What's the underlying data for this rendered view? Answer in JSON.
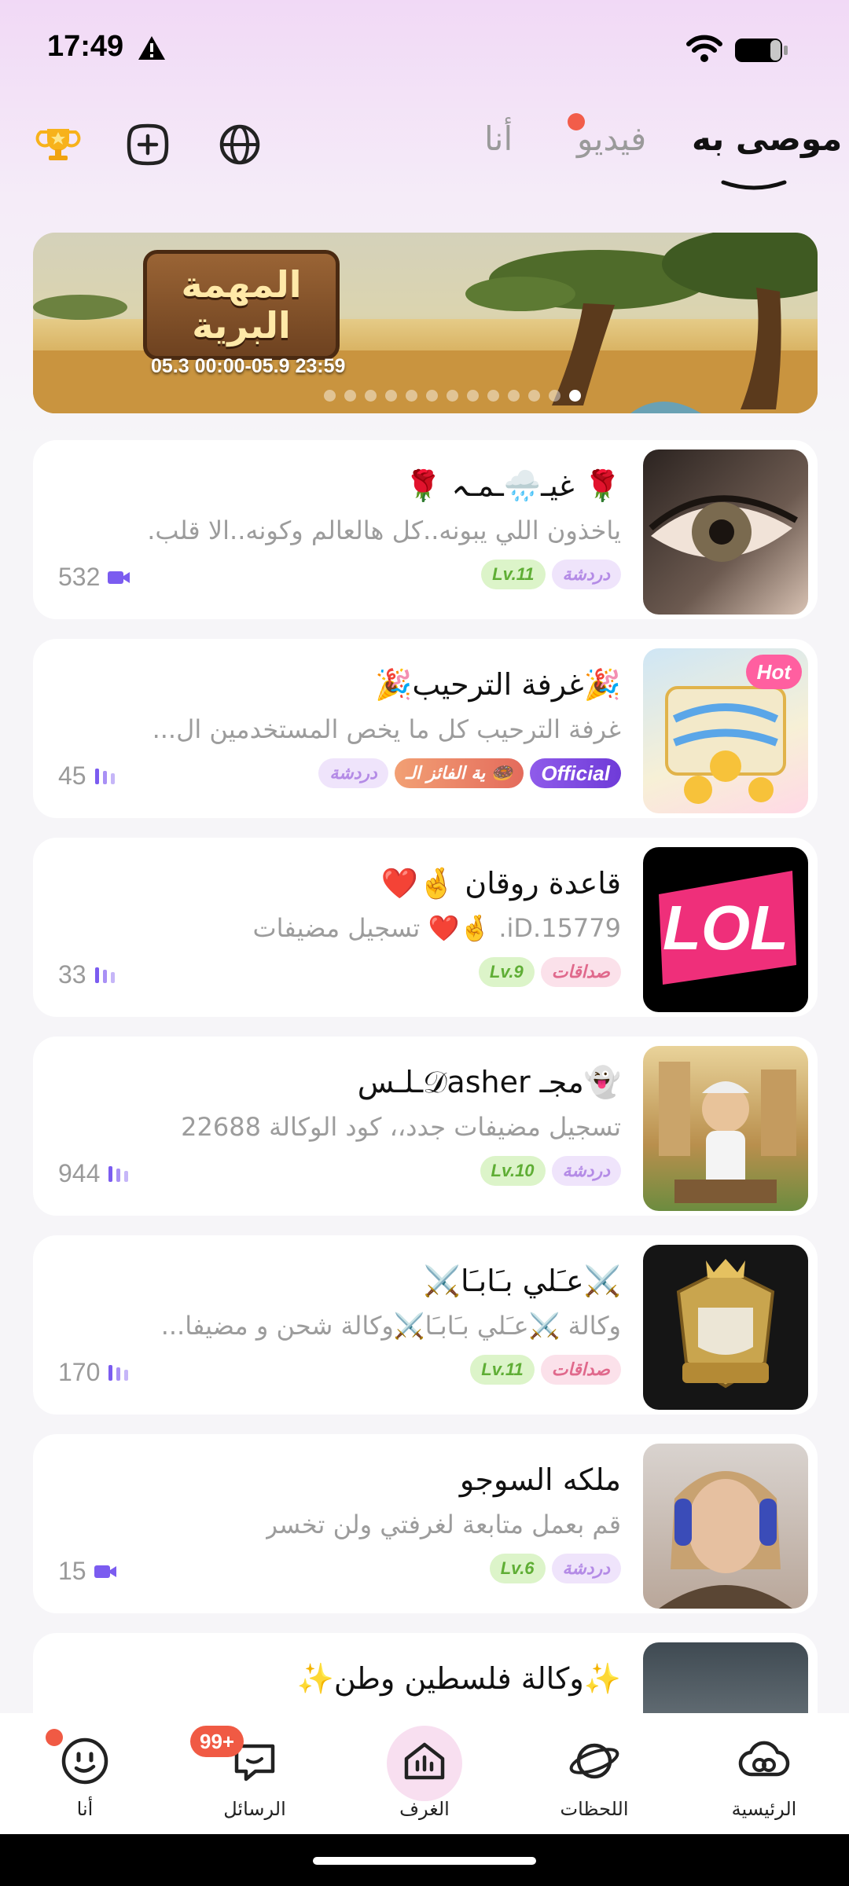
{
  "status_bar": {
    "time": "17:49"
  },
  "header": {
    "tabs": [
      {
        "label": "موصى به",
        "active": true
      },
      {
        "label": "فيديو",
        "active": false,
        "dot": true
      },
      {
        "label": "أنا",
        "active": false
      }
    ],
    "icons": [
      "trophy-icon",
      "add-circle-icon",
      "globe-icon"
    ]
  },
  "banner": {
    "title_line1": "المهمة",
    "title_line2": "البرية",
    "date_range": "05.3 00:00-05.9 23:59",
    "page_count": 13,
    "active_page": 13
  },
  "rooms": [
    {
      "title": "🌹 غيـ🌧️ـمـہ 🌹",
      "desc": "ياخذون اللي يبونه..كل هالعالم وكونه..الا قلب.",
      "tags": [
        {
          "type": "chat",
          "label": "دردشة"
        },
        {
          "type": "lv",
          "label": "Lv.11"
        }
      ],
      "count": "532",
      "count_icon": "video-camera-icon",
      "thumb": "woman-eye"
    },
    {
      "title": "🎉غرفة الترحيب🎉",
      "desc": "غرفة الترحيب كل ما يخص المستخدمين ال...",
      "tags": [
        {
          "type": "official",
          "label": "Official"
        },
        {
          "type": "winner",
          "label": "🍩 ية الفائز الـ"
        },
        {
          "type": "chat",
          "label": "دردشة"
        }
      ],
      "count": "45",
      "count_icon": "audio-bars-icon",
      "thumb": "welcome",
      "hot_label": "Hot"
    },
    {
      "title": "قاعدة روقان 🤞❤️",
      "desc": "iD.15779. 🤞❤️ تسجيل مضيفات",
      "tags": [
        {
          "type": "friend",
          "label": "صداقات"
        },
        {
          "type": "lv",
          "label": "Lv.9"
        }
      ],
      "count": "33",
      "count_icon": "audio-bars-icon",
      "thumb": "lol",
      "thumb_text": "LOL"
    },
    {
      "title": "👻مجـ 𝒟asherـلـس",
      "desc": "تسجيل مضيفات جدد،، كود الوكالة 22688",
      "tags": [
        {
          "type": "chat",
          "label": "دردشة"
        },
        {
          "type": "lv",
          "label": "Lv.10"
        }
      ],
      "count": "944",
      "count_icon": "audio-bars-icon",
      "thumb": "cartoon-man"
    },
    {
      "title": "⚔️عـَلي بـَابـَا⚔️",
      "desc": "وكالة ⚔️عـَلي بـَابـَا⚔️وكالة شحن و مضيفا...",
      "tags": [
        {
          "type": "friend",
          "label": "صداقات"
        },
        {
          "type": "lv",
          "label": "Lv.11"
        }
      ],
      "count": "170",
      "count_icon": "audio-bars-icon",
      "thumb": "crest"
    },
    {
      "title": "ملكه السوجو",
      "desc": "قم بعمل متابعة لغرفتي ولن تخسر",
      "tags": [
        {
          "type": "chat",
          "label": "دردشة"
        },
        {
          "type": "lv",
          "label": "Lv.6"
        }
      ],
      "count": "15",
      "count_icon": "video-camera-icon",
      "thumb": "woman-headphones"
    },
    {
      "title": "✨وكالة فلسطين وطن✨",
      "desc": "",
      "tags": [],
      "count": "",
      "count_icon": "",
      "thumb": "dark"
    }
  ],
  "bottom_nav": [
    {
      "label": "أنا",
      "icon": "smiley-icon"
    },
    {
      "label": "الرسائل",
      "icon": "chat-bubble-icon",
      "badge": "99+"
    },
    {
      "label": "الغرف",
      "icon": "rooms-home-icon",
      "active": true
    },
    {
      "label": "اللحظات",
      "icon": "planet-icon"
    },
    {
      "label": "الرئيسية",
      "icon": "cloud-link-icon"
    }
  ],
  "colors": {
    "accent": "#7b5cf0",
    "badge": "#f05a44",
    "tag_chat": "#b48be6",
    "tag_friend": "#e0698c",
    "tag_lv": "#5fae35"
  }
}
